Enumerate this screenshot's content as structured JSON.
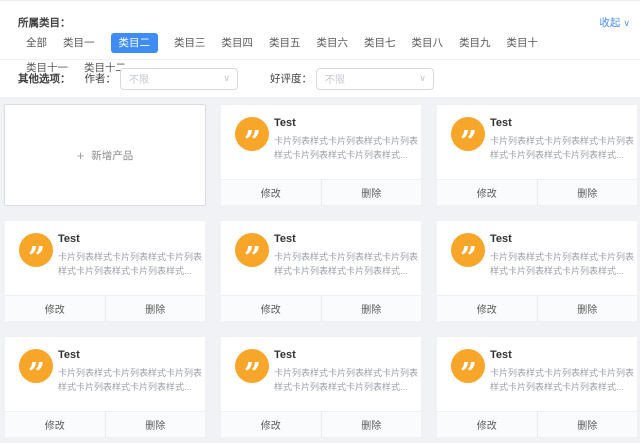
{
  "filters": {
    "category_label": "所属类目：",
    "categories": [
      "全部",
      "类目一",
      "类目二",
      "类目三",
      "类目四",
      "类目五",
      "类目六",
      "类目七",
      "类目八",
      "类目九",
      "类目十",
      "类目十一",
      "类目十二"
    ],
    "selected_category": "类目二",
    "collapse_label": "收起",
    "collapse_chevron": "∨",
    "options_label": "其他选项：",
    "author_label": "作者：",
    "author_placeholder": "不限",
    "author_chevron": "∨",
    "rating_label": "好评度：",
    "rating_placeholder": "不限",
    "rating_chevron": "∨"
  },
  "add_card": {
    "plus": "+",
    "label": "新增产品"
  },
  "card_icon": {
    "glyph": "”",
    "bg_color": "#f8a62a"
  },
  "actions": {
    "edit": "修改",
    "delete": "删除"
  },
  "cards": [
    {
      "title": "Test",
      "description": "卡片列表样式卡片列表样式卡片列表样式卡片列表样式卡片列表样式..."
    },
    {
      "title": "Test",
      "description": "卡片列表样式卡片列表样式卡片列表样式卡片列表样式卡片列表样式..."
    },
    {
      "title": "Test",
      "description": "卡片列表样式卡片列表样式卡片列表样式卡片列表样式卡片列表样式..."
    },
    {
      "title": "Test",
      "description": "卡片列表样式卡片列表样式卡片列表样式卡片列表样式卡片列表样式..."
    },
    {
      "title": "Test",
      "description": "卡片列表样式卡片列表样式卡片列表样式卡片列表样式卡片列表样式..."
    },
    {
      "title": "Test",
      "description": "卡片列表样式卡片列表样式卡片列表样式卡片列表样式卡片列表样式..."
    },
    {
      "title": "Test",
      "description": "卡片列表样式卡片列表样式卡片列表样式卡片列表样式卡片列表样式..."
    },
    {
      "title": "Test",
      "description": "卡片列表样式卡片列表样式卡片列表样式卡片列表样式卡片列表样式..."
    }
  ],
  "colors": {
    "accent_blue": "#3d8df5",
    "link_blue": "#4b8ff7",
    "icon_amber": "#f8a62a"
  }
}
